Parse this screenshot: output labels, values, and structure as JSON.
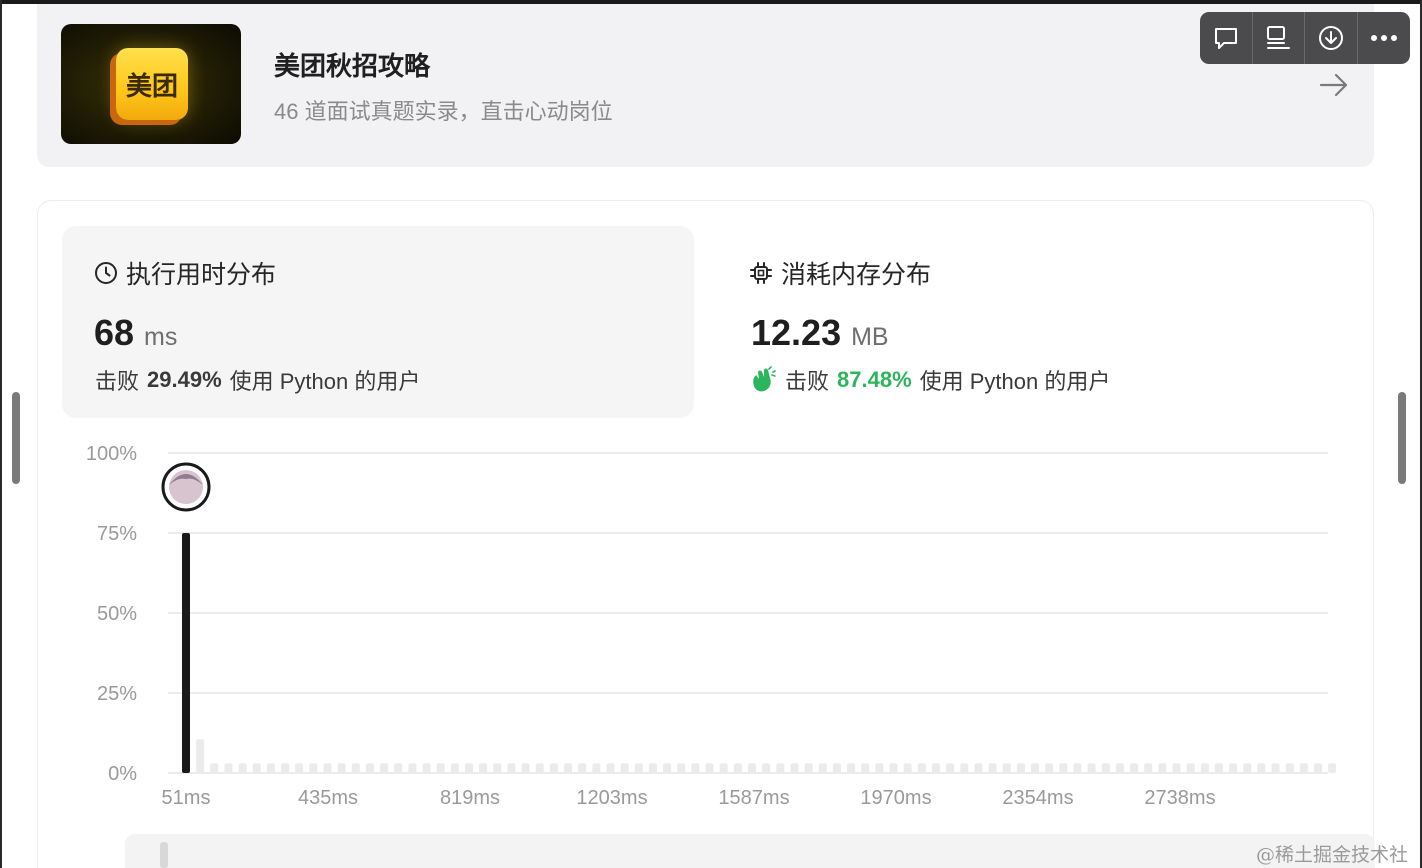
{
  "promo": {
    "logo_text": "美团",
    "title": "美团秋招攻略",
    "subtitle": "46 道面试真题实录，直击心动岗位",
    "arrow_icon": "arrow-right-icon"
  },
  "toolbar": {
    "buttons": [
      "comment-icon",
      "outline-icon",
      "download-icon",
      "more-icon"
    ]
  },
  "runtime": {
    "heading": "执行用时分布",
    "icon": "clock-icon",
    "value": "68",
    "unit": "ms",
    "beats_prefix": "击败",
    "beats_pct": "29.49%",
    "beats_suffix": "使用 Python 的用户"
  },
  "memory": {
    "heading": "消耗内存分布",
    "icon": "chip-icon",
    "value": "12.23",
    "unit": "MB",
    "beats_prefix": "击败",
    "beats_pct": "87.48%",
    "beats_suffix": "使用 Python 的用户",
    "badge_icon": "clap-icon"
  },
  "chart_data": {
    "type": "bar",
    "xlabel": "",
    "ylabel": "",
    "ylim": [
      0,
      100
    ],
    "yticks": [
      "100%",
      "75%",
      "50%",
      "25%",
      "0%"
    ],
    "xticks": [
      "51ms",
      "435ms",
      "819ms",
      "1203ms",
      "1587ms",
      "1970ms",
      "2354ms",
      "2738ms"
    ],
    "highlight_index": 0,
    "highlight_marker": "user-avatar",
    "values": [
      75,
      10.5,
      3,
      3,
      3,
      3,
      3,
      3,
      3,
      3,
      3,
      3,
      3,
      3,
      3,
      3,
      3,
      3,
      3,
      3,
      3,
      3,
      3,
      3,
      3,
      3,
      3,
      3,
      3,
      3,
      3,
      3,
      3,
      3,
      3,
      3,
      3,
      3,
      3,
      3,
      3,
      3,
      3,
      3,
      3,
      3,
      3,
      3,
      3,
      3,
      3,
      3,
      3,
      3,
      3,
      3,
      3,
      3,
      3,
      3,
      3,
      3,
      3,
      3,
      3,
      3,
      3,
      3,
      3,
      3,
      3,
      3,
      3,
      3,
      3,
      3,
      3,
      3,
      3,
      3,
      3,
      3
    ],
    "colors": {
      "highlight": "#1a1a1a",
      "other": "#ebebeb",
      "grid": "#e6e6e6",
      "tick": "#9a9a9a"
    }
  },
  "watermark": "@稀土掘金技术社区"
}
